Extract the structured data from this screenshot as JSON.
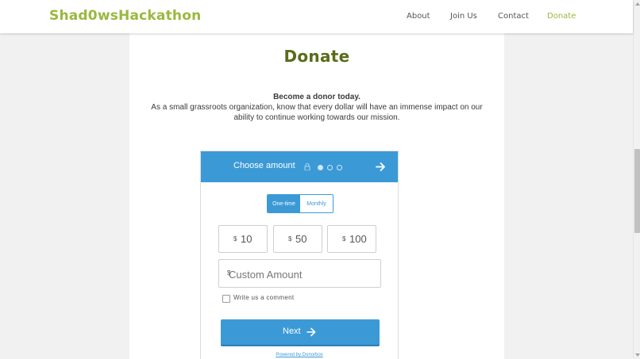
{
  "nav": {
    "brand": "Shad0wsHackathon",
    "links": [
      "About",
      "Join Us",
      "Contact",
      "Donate"
    ],
    "active_link": "Donate",
    "brand_color": "#9ab83e"
  },
  "page": {
    "title": "Donate",
    "intro_lead": "Become a donor today.",
    "intro_body": "As a small grassroots organization, know that every dollar will have an immense impact on our ability to continue working towards our mission."
  },
  "widget": {
    "header_title": "Choose amount",
    "header_icons": [
      "lock-icon",
      "arrow-right-icon"
    ],
    "steps": [
      {
        "state": "active"
      },
      {
        "state": "inactive"
      },
      {
        "state": "inactive"
      }
    ],
    "accent_color": "#3b9ad6",
    "frequency": {
      "options": [
        "One-time",
        "Monthly"
      ],
      "selected": "One-time"
    },
    "amounts": [
      {
        "currency": "$",
        "value": "10"
      },
      {
        "currency": "$",
        "value": "50"
      },
      {
        "currency": "$",
        "value": "100"
      }
    ],
    "custom_amount": {
      "currency": "$",
      "placeholder": "Custom Amount",
      "value": ""
    },
    "comment_label": "Write us a comment",
    "comment_checked": false,
    "next_label": "Next",
    "powered_by": "Powered by Donorbox"
  }
}
